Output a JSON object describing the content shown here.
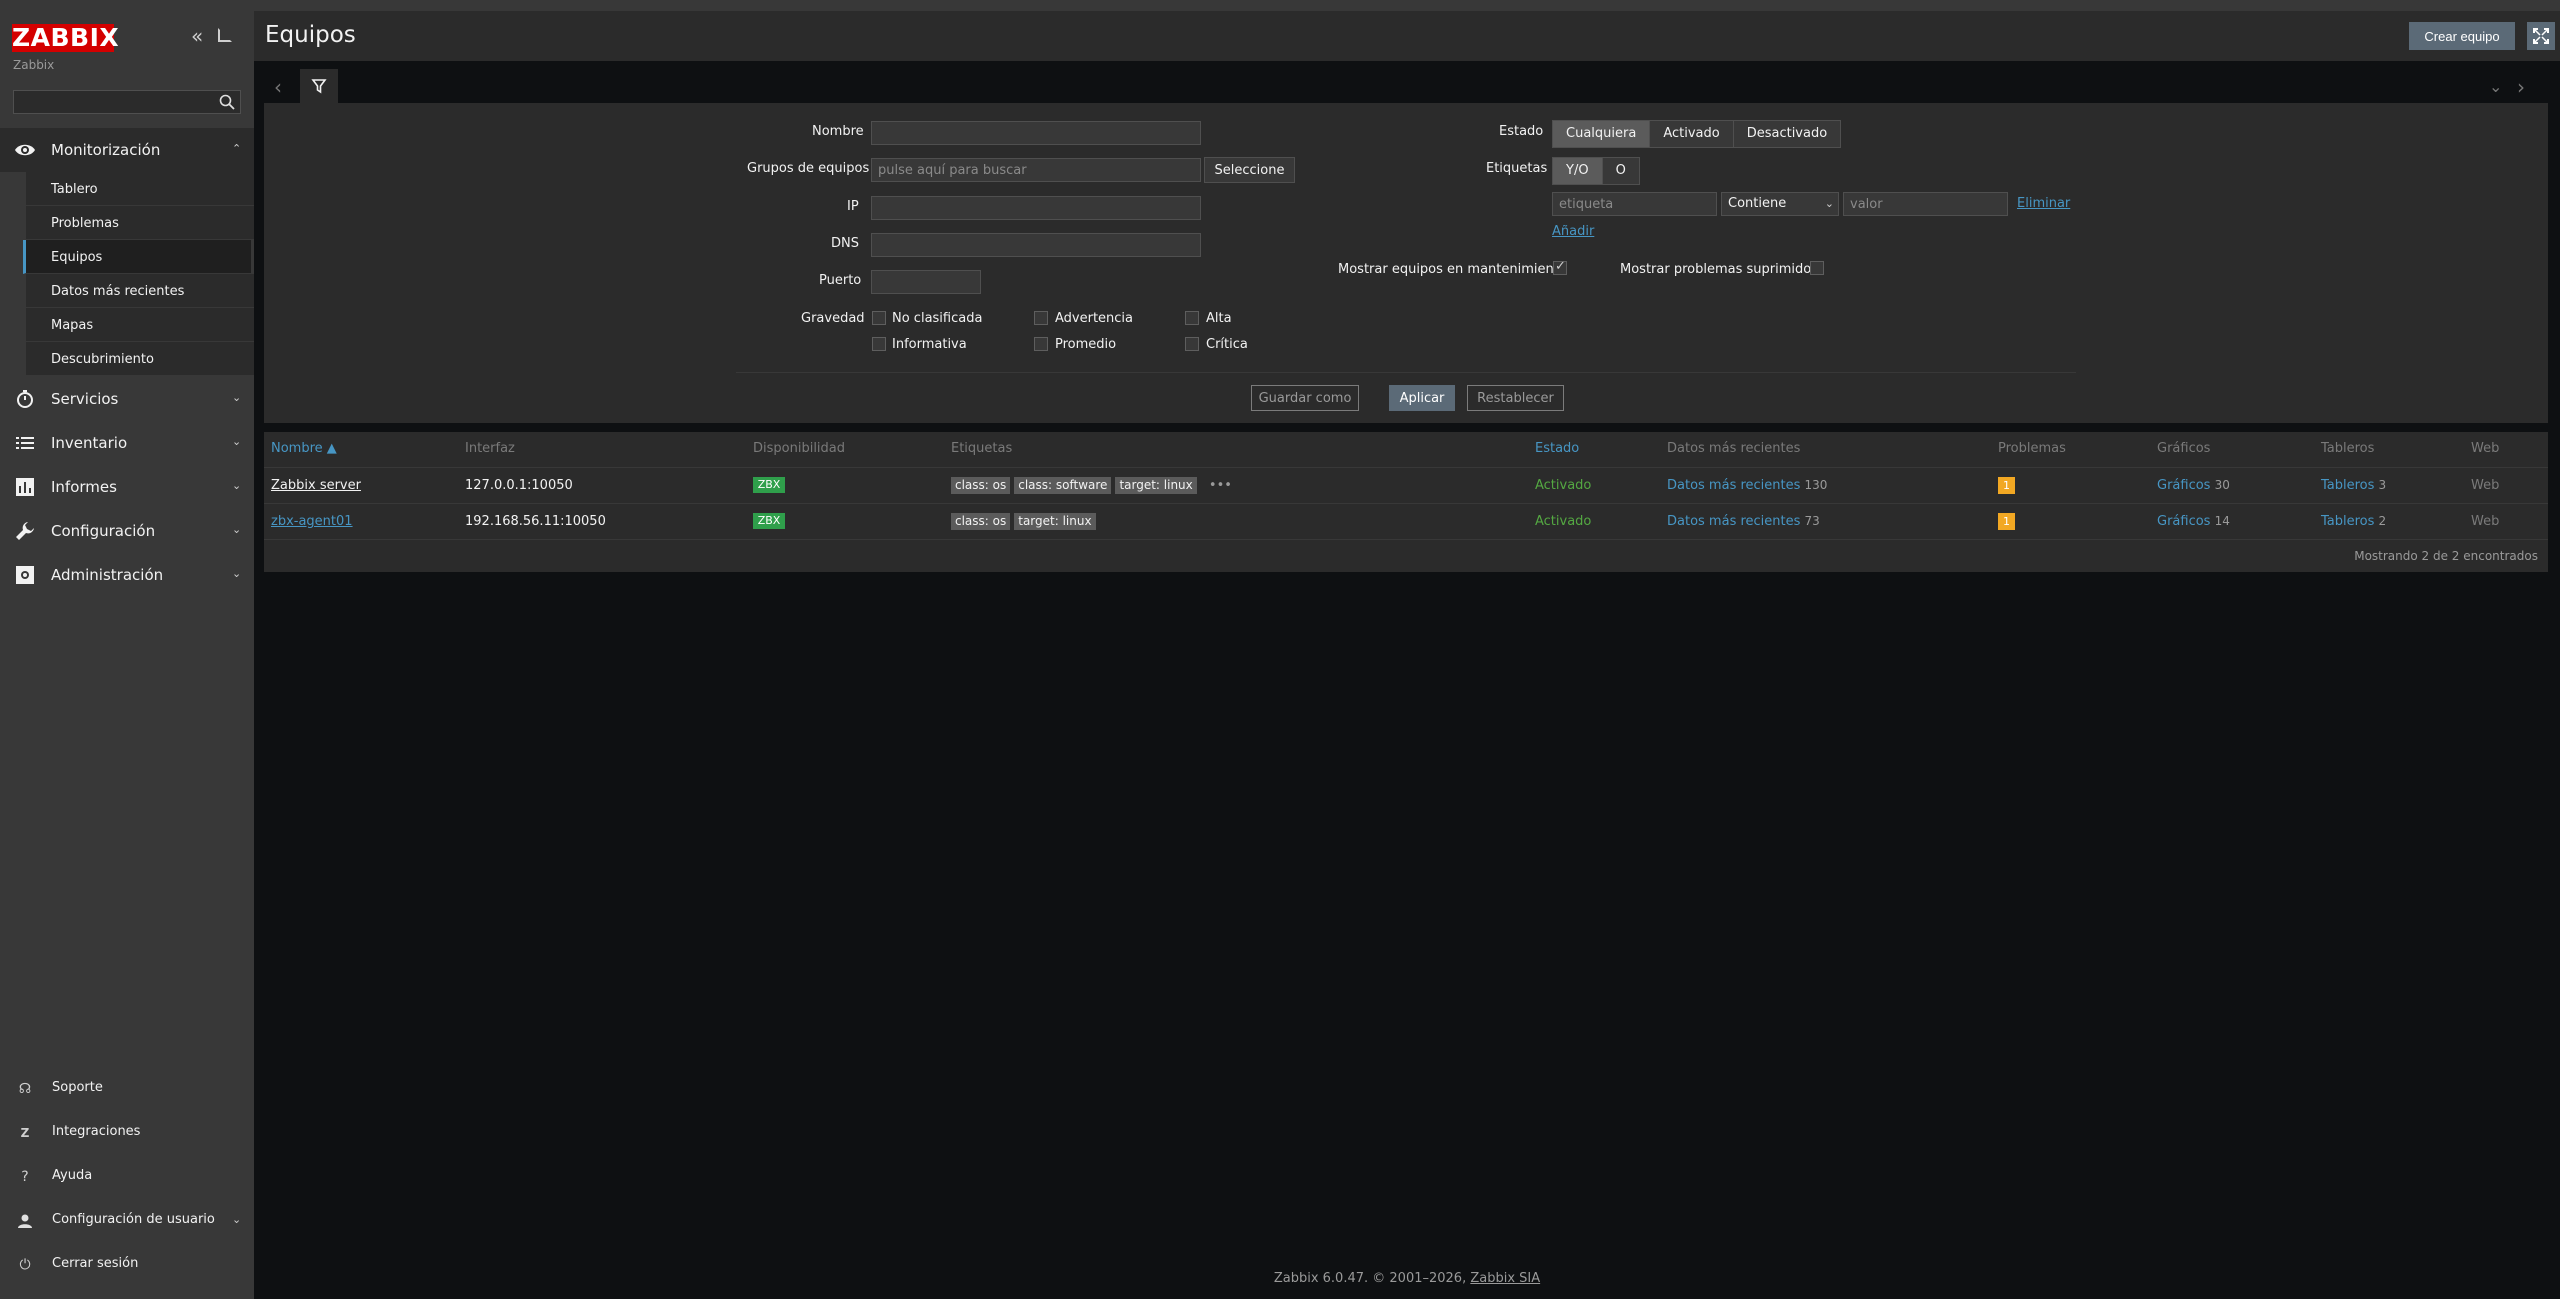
{
  "sidebar": {
    "logo": "ZABBIX",
    "server_name": "Zabbix",
    "search_placeholder": "",
    "menu": [
      {
        "label": "Monitorización",
        "icon": "eye-icon",
        "open": true
      },
      {
        "label": "Servicios",
        "icon": "clock-icon"
      },
      {
        "label": "Inventario",
        "icon": "list-icon"
      },
      {
        "label": "Informes",
        "icon": "bar-chart-icon"
      },
      {
        "label": "Configuración",
        "icon": "wrench-icon"
      },
      {
        "label": "Administración",
        "icon": "gear-icon"
      }
    ],
    "submenu": [
      "Tablero",
      "Problemas",
      "Equipos",
      "Datos más recientes",
      "Mapas",
      "Descubrimiento"
    ],
    "active_submenu": "Equipos",
    "bottom": [
      {
        "label": "Soporte",
        "icon": "headset-icon"
      },
      {
        "label": "Integraciones",
        "icon": "z-icon"
      },
      {
        "label": "Ayuda",
        "icon": "question-icon"
      },
      {
        "label": "Configuración de usuario",
        "icon": "user-icon"
      },
      {
        "label": "Cerrar sesión",
        "icon": "power-icon"
      }
    ]
  },
  "header": {
    "title": "Equipos",
    "create_button": "Crear equipo"
  },
  "filter": {
    "labels": {
      "name": "Nombre",
      "host_groups": "Grupos de equipos",
      "ip": "IP",
      "dns": "DNS",
      "port": "Puerto",
      "severity": "Gravedad",
      "status": "Estado",
      "tags": "Etiquetas",
      "show_maintenance": "Mostrar equipos en mantenimiento",
      "show_suppressed": "Mostrar problemas suprimidos"
    },
    "host_groups_placeholder": "pulse aquí para buscar",
    "select_button": "Seleccione",
    "severities": [
      "No clasificada",
      "Advertencia",
      "Alta",
      "Informativa",
      "Promedio",
      "Crítica"
    ],
    "status_options": [
      "Cualquiera",
      "Activado",
      "Desactivado"
    ],
    "status_selected": "Cualquiera",
    "tag_operator_options": [
      "Y/O",
      "O"
    ],
    "tag_operator_selected": "Y/O",
    "tag_placeholder": "etiqueta",
    "tag_condition": "Contiene",
    "value_placeholder": "valor",
    "remove_link": "Eliminar",
    "add_link": "Añadir",
    "show_maintenance_checked": true,
    "show_suppressed_checked": false,
    "buttons": {
      "save_as": "Guardar como",
      "apply": "Aplicar",
      "reset": "Restablecer"
    }
  },
  "table": {
    "headers": [
      "Nombre ▲",
      "Interfaz",
      "Disponibilidad",
      "Etiquetas",
      "Estado",
      "Datos más recientes",
      "Problemas",
      "Gráficos",
      "Tableros",
      "Web"
    ],
    "rows": [
      {
        "name": "Zabbix server",
        "interface": "127.0.0.1:10050",
        "availability": "ZBX",
        "tags": [
          "class: os",
          "class: software",
          "target: linux"
        ],
        "more": "•••",
        "status": "Activado",
        "latest_data": "Datos más recientes",
        "latest_count": "130",
        "problems": "1",
        "graphs": "Gráficos",
        "graphs_count": "30",
        "dashboards": "Tableros",
        "dashboards_count": "3",
        "web": "Web"
      },
      {
        "name": "zbx-agent01",
        "interface": "192.168.56.11:10050",
        "availability": "ZBX",
        "tags": [
          "class: os",
          "target: linux"
        ],
        "status": "Activado",
        "latest_data": "Datos más recientes",
        "latest_count": "73",
        "problems": "1",
        "graphs": "Gráficos",
        "graphs_count": "14",
        "dashboards": "Tableros",
        "dashboards_count": "2",
        "web": "Web"
      }
    ],
    "footer": "Mostrando 2 de 2 encontrados"
  },
  "footer": {
    "text": "Zabbix 6.0.47. © 2001–2026, ",
    "link": "Zabbix SIA"
  },
  "colors": {
    "accent": "#4796c4",
    "logo": "#d40000",
    "enabled": "#54a842",
    "zbx_available": "#2f9f4b",
    "problem_warning": "#f2a823"
  }
}
